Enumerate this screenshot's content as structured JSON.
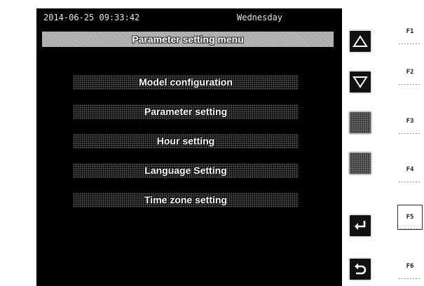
{
  "status_bar": {
    "datetime": "2014-06-25 09:33:42",
    "weekday": "Wednesday"
  },
  "menu": {
    "title": "Parameter setting menu",
    "items": [
      {
        "label": "Model configuration"
      },
      {
        "label": "Parameter setting"
      },
      {
        "label": "Hour setting"
      },
      {
        "label": "Language Setting"
      },
      {
        "label": "Time zone setting"
      }
    ]
  },
  "softkeys": [
    {
      "icon": "arrow-up-icon"
    },
    {
      "icon": "arrow-down-icon"
    },
    {
      "icon": "blank"
    },
    {
      "icon": "blank"
    },
    {
      "icon": "enter-icon"
    },
    {
      "icon": "return-icon"
    }
  ],
  "function_keys": [
    {
      "label": "F1"
    },
    {
      "label": "F2"
    },
    {
      "label": "F3"
    },
    {
      "label": "F4"
    },
    {
      "label": "F5",
      "active": true
    },
    {
      "label": "F6"
    }
  ],
  "colors": {
    "screen_background": "#000000",
    "title_bar": "#a9a9a9",
    "text": "#ffffff"
  }
}
